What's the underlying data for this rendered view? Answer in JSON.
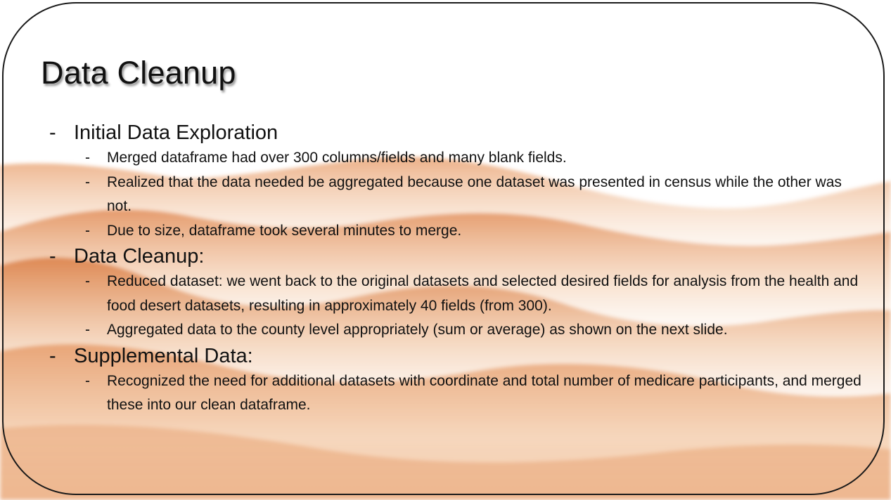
{
  "slide": {
    "title": "Data Cleanup",
    "bullet_marker": "-",
    "sections": [
      {
        "heading": "Initial Data Exploration",
        "items": [
          "Merged dataframe had over 300 columns/fields and many blank fields.",
          "Realized that the data needed be aggregated because one dataset was presented in census while the other was not.",
          "Due to size, dataframe took several minutes to merge."
        ]
      },
      {
        "heading": "Data Cleanup:",
        "items": [
          "Reduced dataset:  we went back to the original datasets and selected desired fields for analysis from the health and food desert datasets, resulting in approximately 40 fields (from 300).",
          "Aggregated data to the county level appropriately (sum or average) as shown on the next slide."
        ]
      },
      {
        "heading": "Supplemental Data:",
        "items": [
          "Recognized the need for additional datasets with coordinate and total number of medicare participants, and merged these into our clean dataframe."
        ]
      }
    ]
  },
  "theme": {
    "text_color": "#111111",
    "accent_dark": "#d9834a",
    "accent_light": "#f7dcc4",
    "frame_color": "#1a1a1a"
  }
}
